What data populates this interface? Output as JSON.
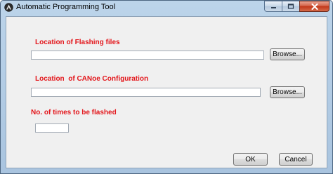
{
  "window": {
    "title": "Automatic Programming Tool"
  },
  "form": {
    "flashing_label": "Location of Flashing files",
    "flashing_path": "",
    "canoe_label": "Location  of CANoe Configuration",
    "canoe_path": "",
    "times_label": "No. of times to be flashed",
    "times_value": "",
    "browse_label": "Browse...",
    "ok_label": "OK",
    "cancel_label": "Cancel"
  },
  "icons": {
    "app": "app-logo-icon",
    "minimize": "minimize-icon",
    "maximize": "maximize-icon",
    "close": "close-icon"
  },
  "colors": {
    "label_red": "#e3161b",
    "close_button": "#c2371a"
  }
}
